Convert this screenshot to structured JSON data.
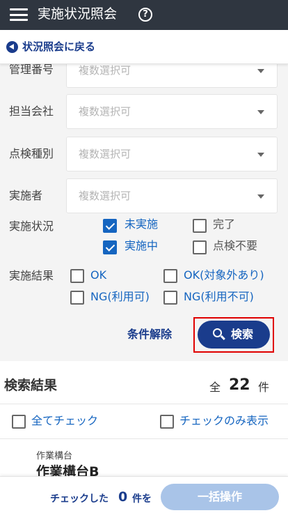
{
  "header": {
    "title": "実施状況照会",
    "help_icon": "help-circle-icon",
    "menu_icon": "hamburger-menu-icon"
  },
  "back": {
    "label": "状況照会に戻る",
    "icon": "back-arrow-icon"
  },
  "filters": {
    "kanri": {
      "label": "管理番号",
      "placeholder": "複数選択可"
    },
    "tanto": {
      "label": "担当会社",
      "placeholder": "複数選択可"
    },
    "tenken": {
      "label": "点検種別",
      "placeholder": "複数選択可"
    },
    "jisshisha": {
      "label": "実施者",
      "placeholder": "複数選択可"
    },
    "status": {
      "label": "実施状況",
      "options": [
        {
          "label": "未実施",
          "checked": true
        },
        {
          "label": "完了",
          "checked": false
        },
        {
          "label": "実施中",
          "checked": true
        },
        {
          "label": "点検不要",
          "checked": false
        }
      ]
    },
    "result": {
      "label": "実施結果",
      "options": [
        {
          "label": "OK",
          "checked": false
        },
        {
          "label": "OK(対象外あり)",
          "checked": false
        },
        {
          "label": "NG(利用可)",
          "checked": false
        },
        {
          "label": "NG(利用不可)",
          "checked": false
        }
      ]
    },
    "clear_label": "条件解除",
    "search_label": "検索"
  },
  "results": {
    "title": "検索結果",
    "count_prefix": "全",
    "count": "22",
    "count_suffix": "件",
    "check_all_label": "全てチェック",
    "show_checked_label": "チェックのみ表示"
  },
  "card": {
    "subtitle": "作業構台",
    "title": "作業構台B"
  },
  "bottom": {
    "prefix": "チェックした",
    "count": "0",
    "suffix": "件を",
    "bulk_label": "一括操作"
  },
  "colors": {
    "header_bg": "#2f3640",
    "accent": "#1a3c8c",
    "checkbox_checked": "#1565c0",
    "highlight": "#e00000"
  }
}
